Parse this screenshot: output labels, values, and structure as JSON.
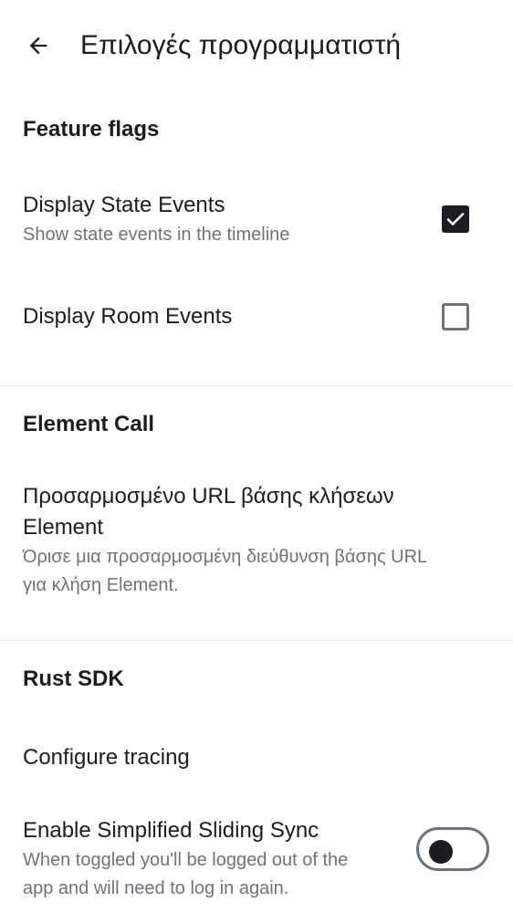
{
  "header": {
    "title": "Επιλογές προγραμματιστή",
    "back_icon": "arrow-left-icon"
  },
  "sections": {
    "feature_flags": {
      "title": "Feature flags",
      "display_state_events": {
        "title": "Display State Events",
        "subtitle": "Show state events in the timeline",
        "checked": true
      },
      "display_room_events": {
        "title": "Display Room Events",
        "checked": false
      }
    },
    "element_call": {
      "title": "Element Call",
      "custom_url": {
        "title_line1": "Προσαρμοσμένο URL βάσης κλήσεων",
        "title_line2": "Element",
        "subtitle_line1": "Όρισε μια προσαρμοσμένη διεύθυνση βάσης URL",
        "subtitle_line2": "για κλήση Element."
      }
    },
    "rust_sdk": {
      "title": "Rust SDK",
      "configure_tracing": "Configure tracing",
      "simplified_sliding_sync": {
        "title": "Enable Simplified Sliding Sync",
        "subtitle_line1": "When toggled you'll be logged out of the",
        "subtitle_line2": "app and will need to log in again.",
        "enabled": false
      }
    }
  },
  "colors": {
    "text_primary": "#1b1d22",
    "text_secondary": "#6e737d",
    "divider": "#e6e8eb",
    "background": "#ffffff"
  }
}
